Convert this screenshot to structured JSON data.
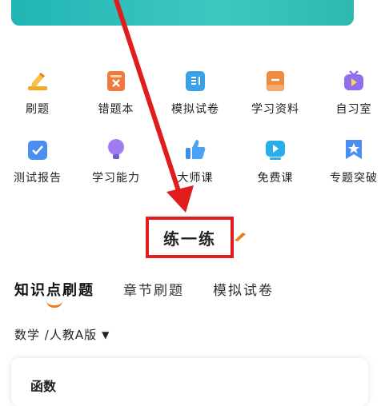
{
  "grid": [
    {
      "name": "pencil-icon",
      "label": "刷题",
      "color": "#f5a623"
    },
    {
      "name": "notebook-icon",
      "label": "错题本",
      "color": "#f07a3c"
    },
    {
      "name": "exam-icon",
      "label": "模拟试卷",
      "color": "#3aa0e8"
    },
    {
      "name": "book-icon",
      "label": "学习资料",
      "color": "#f08a3c"
    },
    {
      "name": "tv-icon",
      "label": "自习室",
      "color": "#8e6ff0"
    },
    {
      "name": "report-icon",
      "label": "测试报告",
      "color": "#4a8ff0"
    },
    {
      "name": "bulb-icon",
      "label": "学习能力",
      "color": "#a07cf0"
    },
    {
      "name": "thumb-icon",
      "label": "大师课",
      "color": "#3a8ff0"
    },
    {
      "name": "video-icon",
      "label": "免费课",
      "color": "#2aaee8"
    },
    {
      "name": "star-icon",
      "label": "专题突破",
      "color": "#4a8ff0"
    }
  ],
  "section_title": "练一练",
  "tabs": [
    "知识点刷题",
    "章节刷题",
    "模拟试卷"
  ],
  "subject": "数学 /人教A版",
  "card_text": "函数",
  "accent": "#e01c1c",
  "tab_accent": "#f07a1c"
}
